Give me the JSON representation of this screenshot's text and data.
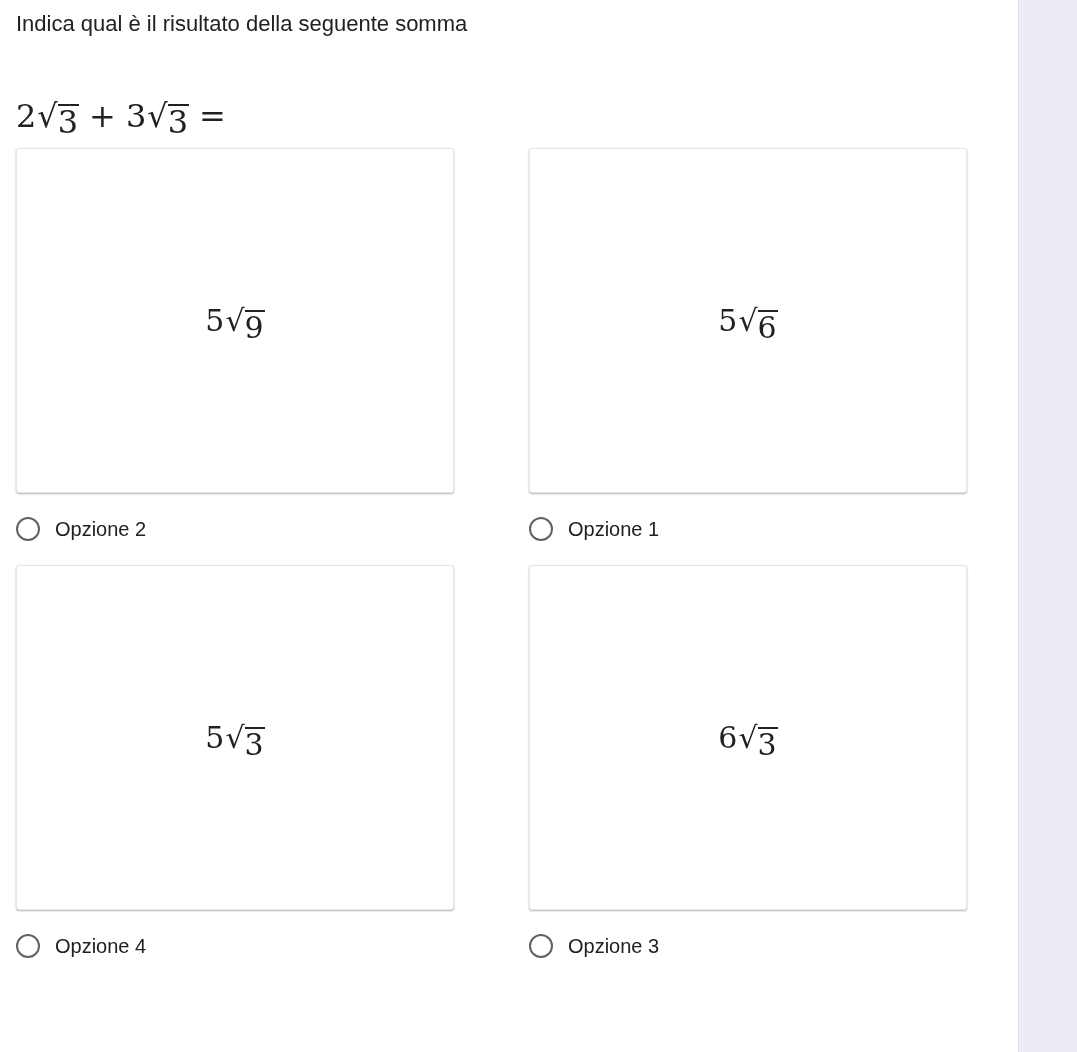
{
  "question": {
    "title": "Indica qual è il risultato della seguente somma",
    "expression": [
      {
        "kind": "root",
        "coefficient": "2",
        "root": "√",
        "radicand": "3"
      },
      {
        "kind": "operator",
        "text": "+"
      },
      {
        "kind": "root",
        "coefficient": "3",
        "root": "√",
        "radicand": "3"
      },
      {
        "kind": "operator",
        "text": "="
      }
    ]
  },
  "options": [
    {
      "label": "Opzione 2",
      "selected": false,
      "math": {
        "coefficient": "5",
        "root": "√",
        "radicand": "9"
      }
    },
    {
      "label": "Opzione 1",
      "selected": false,
      "math": {
        "coefficient": "5",
        "root": "√",
        "radicand": "6"
      }
    },
    {
      "label": "Opzione 4",
      "selected": false,
      "math": {
        "coefficient": "5",
        "root": "√",
        "radicand": "3"
      }
    },
    {
      "label": "Opzione 3",
      "selected": false,
      "math": {
        "coefficient": "6",
        "root": "√",
        "radicand": "3"
      }
    }
  ]
}
